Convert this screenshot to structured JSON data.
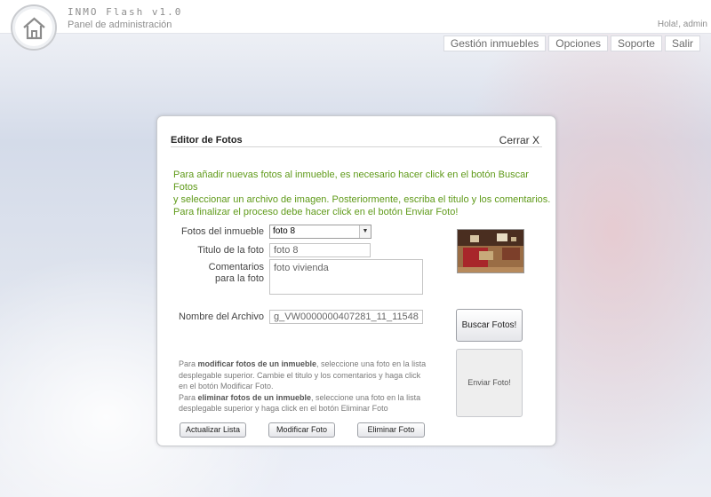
{
  "header": {
    "title": "INMO Flash v1.0",
    "subtitle": "Panel de administración",
    "greeting": "Hola!, admin"
  },
  "nav": {
    "items": [
      "Gestión inmuebles",
      "Opciones",
      "Soporte",
      "Salir"
    ]
  },
  "editor": {
    "title": "Editor de Fotos",
    "close_label": "Cerrar X",
    "intro_lines": [
      "Para añadir nuevas fotos al inmueble, es necesario hacer click en el botón Buscar Fotos",
      "y seleccionar un archivo de imagen. Posteriormente, escriba el titulo y los comentarios.",
      "Para finalizar el proceso debe hacer click en el botón Enviar Foto!"
    ],
    "photos_label": "Fotos del inmueble",
    "photos_selected": "foto 8",
    "title_label": "Titulo de la foto",
    "title_value": "foto 8",
    "comments_label_1": "Comentarios",
    "comments_label_2": "para la foto",
    "comments_value": "foto vivienda",
    "filename_label": "Nombre del Archivo",
    "filename_value": "g_VW0000000407281_11_11548",
    "search_button": "Buscar Fotos!",
    "send_button": "Enviar Foto!",
    "help": {
      "p1_prefix": "Para ",
      "p1_bold": "modificar fotos de un inmueble",
      "p1_text": ", seleccione una foto en la lista desplegable superior. Cambie el titulo y los comentarios y haga click en el botón Modificar Foto.",
      "p2_prefix": "Para ",
      "p2_bold": "eliminar fotos de un inmueble",
      "p2_text": ", seleccione una foto en la lista desplegable superior y haga click en el botón Eliminar Foto"
    },
    "buttons": {
      "refresh": "Actualizar Lista",
      "modify": "Modificar Foto",
      "delete": "Eliminar Foto"
    }
  }
}
